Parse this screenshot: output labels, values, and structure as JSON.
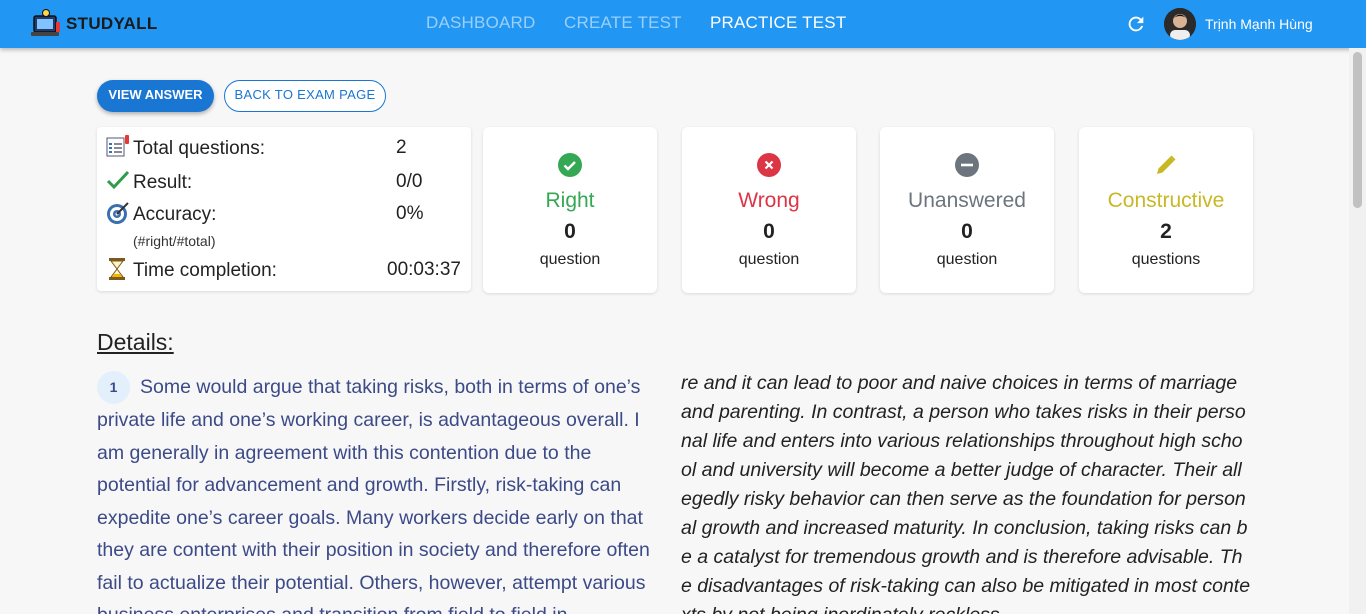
{
  "nav": {
    "brand": "STUDYALL",
    "links": [
      "DASHBOARD",
      "CREATE TEST",
      "PRACTICE TEST"
    ],
    "username": "Trịnh Mạnh Hùng",
    "accent": "#2196f3"
  },
  "actions": {
    "view_answer": "VIEW ANSWER",
    "back_to_exam": "BACK TO EXAM PAGE"
  },
  "summary": {
    "total_label": "Total questions:",
    "total_value": "2",
    "result_label": "Result:",
    "result_value": "0/0",
    "accuracy_label": "Accuracy:",
    "accuracy_value": "0%",
    "accuracy_note": "(#right/#total)",
    "time_label": "Time completion:",
    "time_value": "00:03:37"
  },
  "stats": [
    {
      "title": "Right",
      "count": "0",
      "unit": "question",
      "color": "#34a853",
      "icon": "check-circle-icon"
    },
    {
      "title": "Wrong",
      "count": "0",
      "unit": "question",
      "color": "#dc3545",
      "icon": "x-circle-icon"
    },
    {
      "title": "Unanswered",
      "count": "0",
      "unit": "question",
      "color": "#6c757d",
      "icon": "minus-circle-icon"
    },
    {
      "title": "Constructive",
      "count": "2",
      "unit": "questions",
      "color": "#c9b826",
      "icon": "pencil-icon"
    }
  ],
  "details": {
    "title": "Details:",
    "question_number": "1",
    "essay_left": "Some would argue that taking risks, both in terms of one’s private life and one’s working career, is advantageous overall. I am generally in agreement with this contention due to the potential for advancement and growth. Firstly, risk-taking can expedite one’s career goals. Many workers decide early on that they are content with their position in society and therefore often fail to actualize their potential. Others, however, attempt various business enterprises and transition from field to field in",
    "essay_right": "re and it can lead to poor and naive choices in terms of marriage and parenting. In contrast, a person who takes risks in their personal life and enters into various relationships throughout high school and university will become a better judge of character. Their allegedly risky behavior can then serve as the foundation for personal growth and increased maturity. In conclusion, taking risks can be a catalyst for tremendous growth and is therefore advisable. The disadvantages of risk-taking can also be mitigated in most contexts by not being inordinately reckless."
  }
}
